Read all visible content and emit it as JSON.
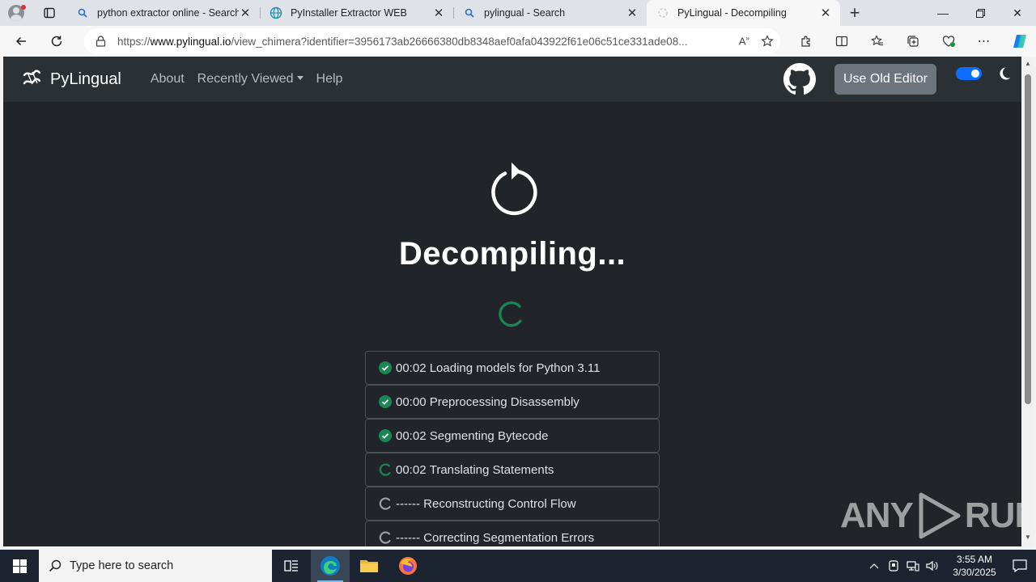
{
  "browser": {
    "tabs": [
      {
        "title": "python extractor online - Search",
        "icon": "search-icon",
        "active": false
      },
      {
        "title": "PyInstaller Extractor WEB",
        "icon": "globe-icon",
        "active": false
      },
      {
        "title": "pylingual - Search",
        "icon": "search-icon",
        "active": false
      },
      {
        "title": "PyLingual - Decompiling",
        "icon": "page-icon",
        "active": true
      }
    ],
    "url_prefix": "https://",
    "url_host": "www.pylingual.io",
    "url_path": "/view_chimera?identifier=3956173ab26666380db8348aef0afa043922f61e06c51ce331ade08..."
  },
  "site": {
    "brand": "PyLingual",
    "nav": {
      "about": "About",
      "recently_viewed": "Recently Viewed",
      "help": "Help"
    },
    "old_editor_label": "Use Old Editor",
    "dark_mode_on": true,
    "accent": "#0d6efd"
  },
  "main": {
    "headline": "Decompiling...",
    "success_color": "#198754",
    "steps": [
      {
        "time": "00:02",
        "label": "Loading models for Python 3.11",
        "status": "done"
      },
      {
        "time": "00:00",
        "label": "Preprocessing Disassembly",
        "status": "done"
      },
      {
        "time": "00:02",
        "label": "Segmenting Bytecode",
        "status": "done"
      },
      {
        "time": "00:02",
        "label": "Translating Statements",
        "status": "running"
      },
      {
        "time": "------",
        "label": "Reconstructing Control Flow",
        "status": "pending"
      },
      {
        "time": "------",
        "label": "Correcting Segmentation Errors",
        "status": "pending"
      }
    ]
  },
  "watermark": {
    "left": "ANY",
    "right": "RUN"
  },
  "taskbar": {
    "search_placeholder": "Type here to search",
    "time": "3:55 AM",
    "date": "3/30/2025"
  }
}
